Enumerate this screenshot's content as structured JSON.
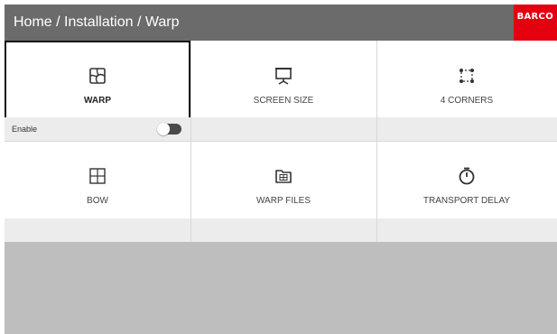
{
  "header": {
    "breadcrumb": "Home / Installation / Warp",
    "logo_text": "BARCO",
    "background_color": "#6b6b6b",
    "logo_color": "#e4000f"
  },
  "tiles": [
    {
      "label": "WARP",
      "icon": "warp-icon",
      "selected": true,
      "enable_label": "Enable",
      "enable_on": false
    },
    {
      "label": "SCREEN SIZE",
      "icon": "screen-size-icon",
      "selected": false
    },
    {
      "label": "4 CORNERS",
      "icon": "four-corners-icon",
      "selected": false
    },
    {
      "label": "BOW",
      "icon": "bow-icon",
      "selected": false
    },
    {
      "label": "WARP FILES",
      "icon": "warp-files-icon",
      "selected": false
    },
    {
      "label": "TRANSPORT DELAY",
      "icon": "transport-delay-icon",
      "selected": false
    }
  ],
  "colors": {
    "footer": "#ececec",
    "empty_area": "#bebebe",
    "selection_border": "#111111"
  }
}
